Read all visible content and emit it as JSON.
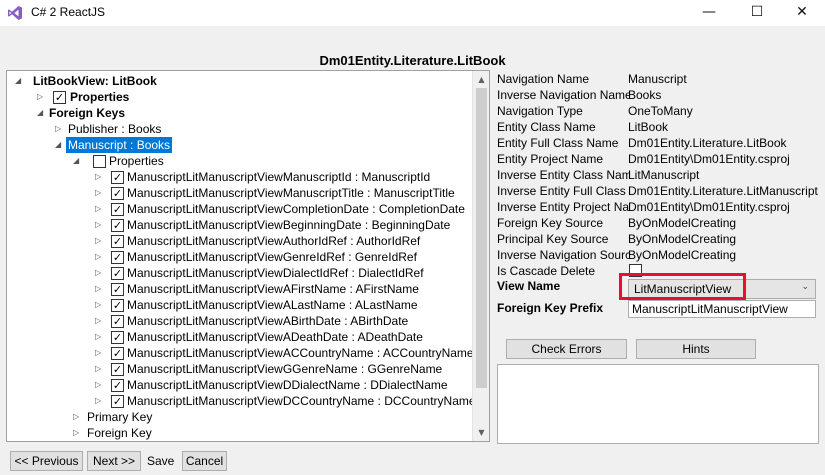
{
  "window": {
    "title": "C# 2 ReactJS",
    "minimize_glyph": "—",
    "maximize_glyph": "☐",
    "close_glyph": "✕",
    "icon": "visual-studio-icon"
  },
  "heading": "Dm01Entity.Literature.LitBook",
  "tree": {
    "root": "LitBookView: LitBook",
    "properties": "Properties",
    "foreign_keys": "Foreign Keys",
    "publisher": "Publisher : Books",
    "manuscript": "Manuscript : Books",
    "manuscript_properties": "Properties",
    "fields": [
      "ManuscriptLitManuscriptViewManuscriptId : ManuscriptId",
      "ManuscriptLitManuscriptViewManuscriptTitle : ManuscriptTitle",
      "ManuscriptLitManuscriptViewCompletionDate : CompletionDate",
      "ManuscriptLitManuscriptViewBeginningDate : BeginningDate",
      "ManuscriptLitManuscriptViewAuthorIdRef : AuthorIdRef",
      "ManuscriptLitManuscriptViewGenreIdRef : GenreIdRef",
      "ManuscriptLitManuscriptViewDialectIdRef : DialectIdRef",
      "ManuscriptLitManuscriptViewAFirstName : AFirstName",
      "ManuscriptLitManuscriptViewALastName : ALastName",
      "ManuscriptLitManuscriptViewABirthDate : ABirthDate",
      "ManuscriptLitManuscriptViewADeathDate : ADeathDate",
      "ManuscriptLitManuscriptViewACCountryName : ACCountryName",
      "ManuscriptLitManuscriptViewGGenreName : GGenreName",
      "ManuscriptLitManuscriptViewDDialectName : DDialectName",
      "ManuscriptLitManuscriptViewDCCountryName : DCCountryName"
    ],
    "primary_key": "Primary Key",
    "foreign_key": "Foreign Key"
  },
  "properties_grid": [
    {
      "label": "Navigation Name",
      "value": "Manuscript"
    },
    {
      "label": "Inverse Navigation Name",
      "value": "Books"
    },
    {
      "label": "Navigation Type",
      "value": "OneToMany"
    },
    {
      "label": "Entity Class Name",
      "value": "LitBook"
    },
    {
      "label": "Entity Full Class Name",
      "value": "Dm01Entity.Literature.LitBook"
    },
    {
      "label": "Entity Project Name",
      "value": "Dm01Entity\\Dm01Entity.csproj"
    },
    {
      "label": "Inverse Entity Class Name",
      "value": "LitManuscript"
    },
    {
      "label": "Inverse Entity Full Class Name",
      "value": "Dm01Entity.Literature.LitManuscript"
    },
    {
      "label": "Inverse Entity Project Name",
      "value": "Dm01Entity\\Dm01Entity.csproj"
    },
    {
      "label": "Foreign Key Source",
      "value": "ByOnModelCreating"
    },
    {
      "label": "Principal Key Source",
      "value": "ByOnModelCreating"
    },
    {
      "label": "Inverse Navigation Source",
      "value": "ByOnModelCreating"
    },
    {
      "label": "Is Cascade Delete",
      "value": ""
    }
  ],
  "view_name": {
    "label": "View Name",
    "value": "LitManuscriptView"
  },
  "foreign_key_prefix": {
    "label": "Foreign Key Prefix",
    "value": "ManuscriptLitManuscriptView"
  },
  "buttons": {
    "check_errors": "Check Errors",
    "hints": "Hints",
    "previous": "<< Previous",
    "next": "Next >>",
    "save": "Save",
    "cancel": "Cancel"
  },
  "colors": {
    "selection": "#0078d7",
    "highlight": "#e8112d",
    "vs_purple": "#865fc5"
  }
}
